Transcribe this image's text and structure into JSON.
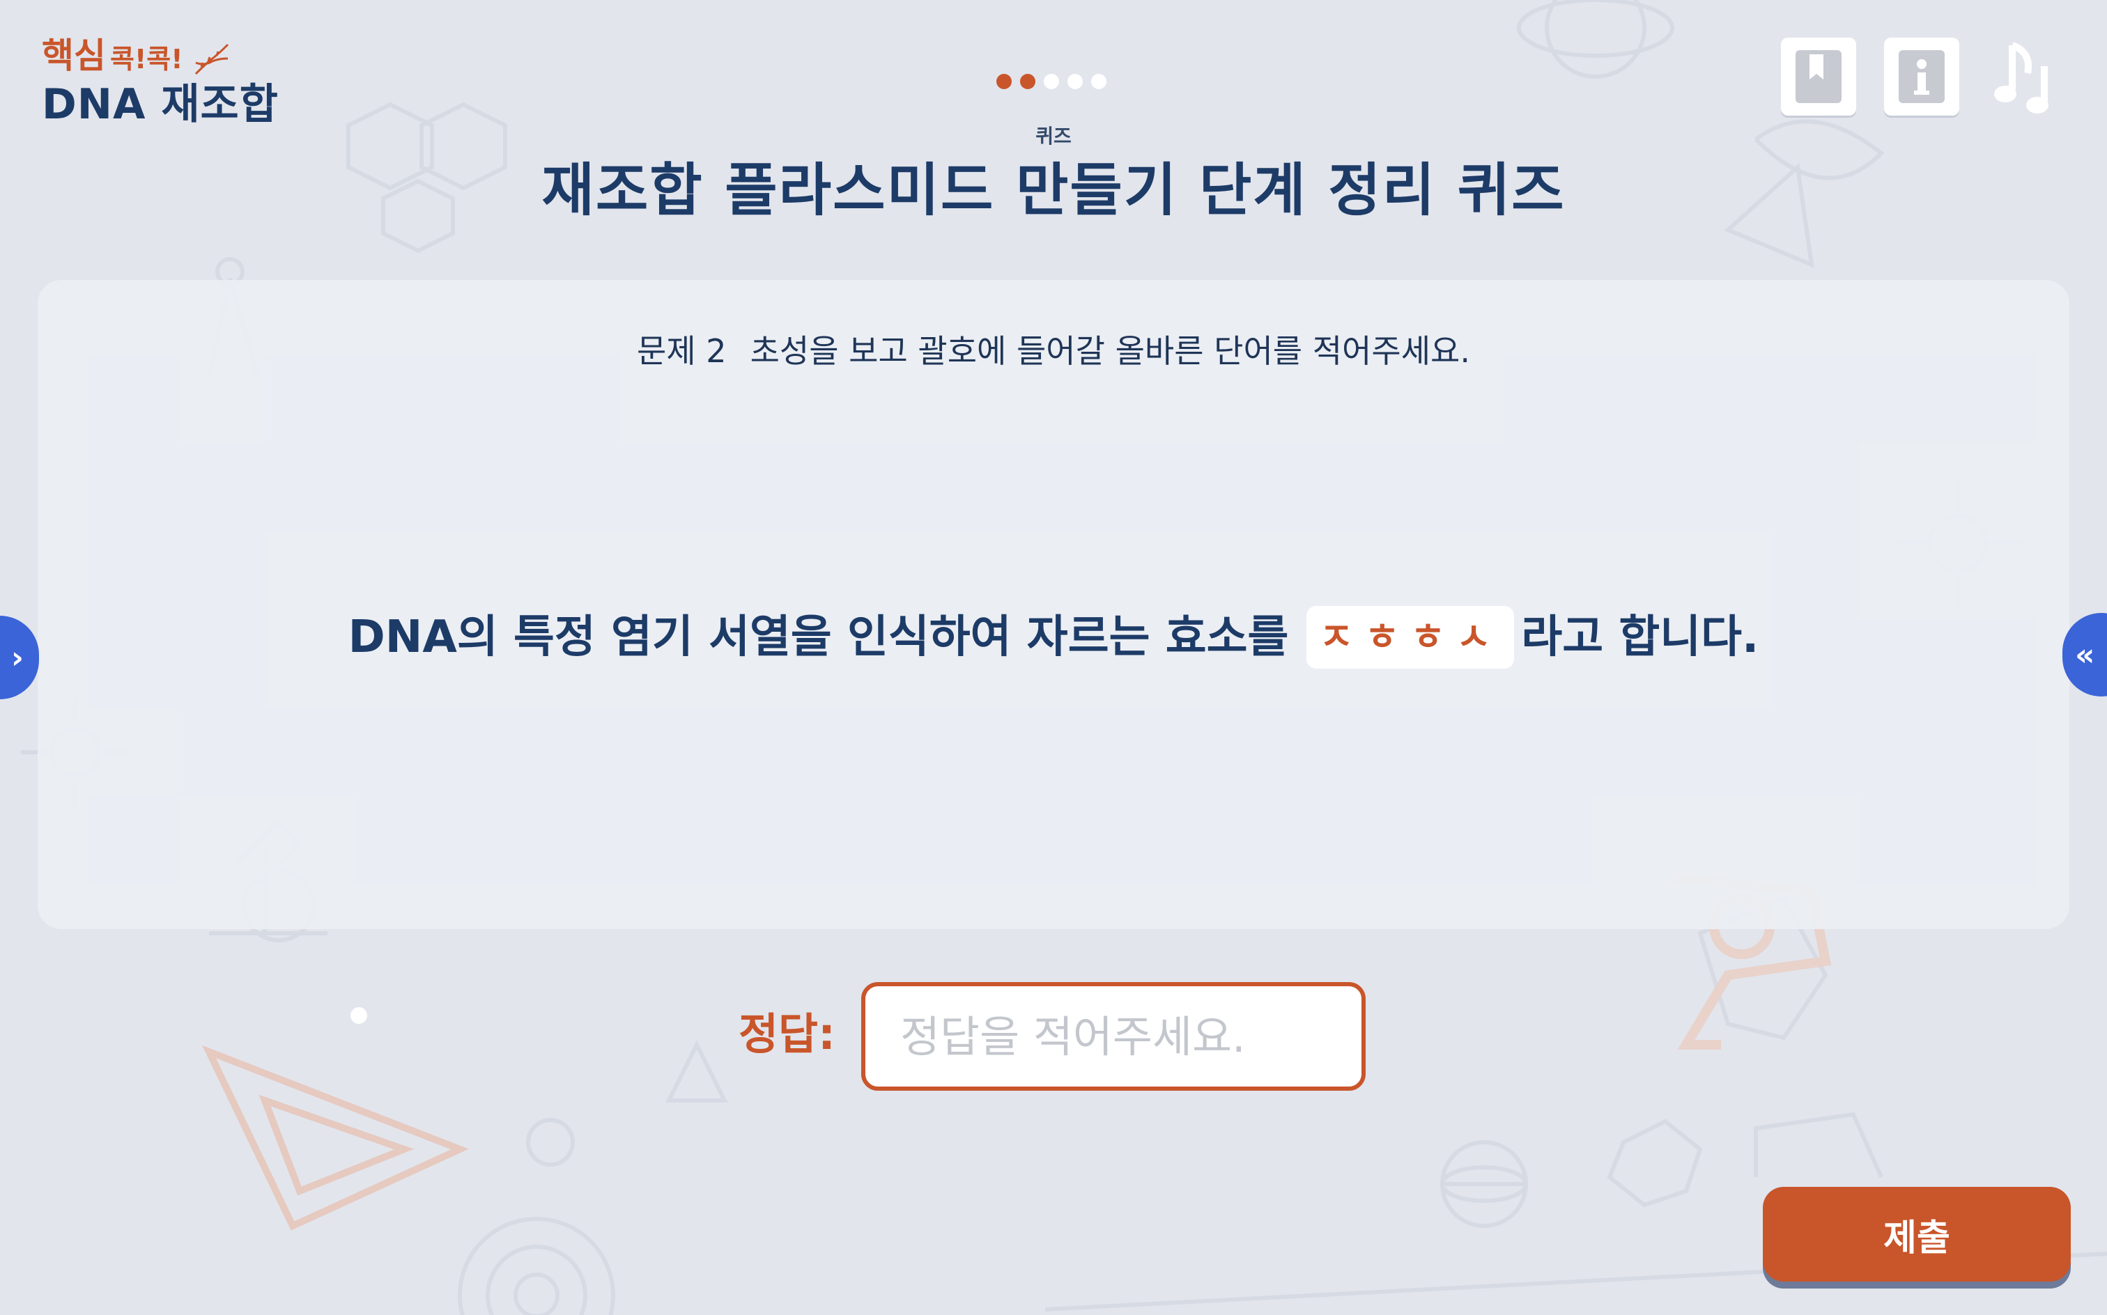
{
  "app": {
    "logo_main": "핵심",
    "logo_sub": "콕!콕!",
    "logo_title": "DNA 재조합"
  },
  "progress": {
    "total_steps": 5,
    "current_step": 2
  },
  "header": {
    "subtitle": "퀴즈",
    "title": "재조합 플라스미드 만들기 단계 정리 퀴즈"
  },
  "question": {
    "number": "문제 2",
    "instruction": "초성을 보고 괄호에 들어갈 올바른 단어를 적어주세요.",
    "sentence_before": "DNA의 특정 염기 서열을 인식하여 자르는 효소를",
    "hint": "ㅈㅎㅎㅅ",
    "sentence_after": "라고 합니다."
  },
  "answer": {
    "label": "정답:",
    "placeholder": "정답을 적어주세요.",
    "value": ""
  },
  "buttons": {
    "submit": "제출",
    "prev": "›",
    "next": "«"
  },
  "icons": {
    "top_right": [
      "bookmark-icon",
      "info-icon",
      "music-icon"
    ],
    "side": [
      "chevron-right-icon",
      "double-chevron-left-icon"
    ]
  },
  "colors": {
    "accent": "#c9552a",
    "navy": "#1d3b67",
    "side_button": "#3a64d8",
    "background": "#e2e5ec"
  }
}
